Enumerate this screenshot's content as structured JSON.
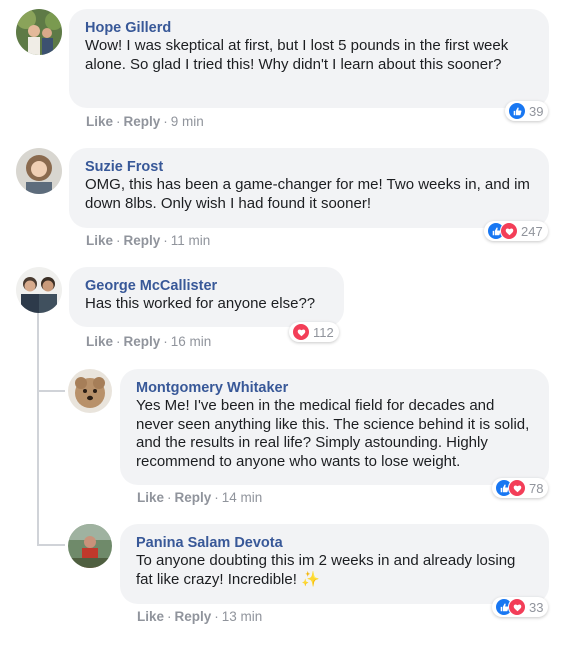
{
  "comments": [
    {
      "name": "Hope Gillerd",
      "text": "Wow! I was skeptical at first, but I lost 5 pounds in the first week alone. So glad I tried this! Why didn't I learn about this sooner?",
      "like": "Like",
      "reply": "Reply",
      "time": "9 min",
      "reaction_count": "39",
      "reactions": [
        "like"
      ]
    },
    {
      "name": "Suzie Frost",
      "text": "OMG, this has been a game-changer for me! Two weeks in, and im down 8lbs. Only wish I had found it sooner!",
      "like": "Like",
      "reply": "Reply",
      "time": "11 min",
      "reaction_count": "247",
      "reactions": [
        "like",
        "love"
      ]
    },
    {
      "name": "George McCallister",
      "text": "Has this worked for anyone else??",
      "like": "Like",
      "reply": "Reply",
      "time": "16 min",
      "reaction_count": "112",
      "reactions": [
        "love"
      ]
    },
    {
      "name": "Montgomery Whitaker",
      "text": "Yes Me! I've been in the medical field for decades and never seen anything like this. The science behind it is solid, and the results in real life? Simply astounding. Highly recommend to anyone who wants to lose weight.",
      "like": "Like",
      "reply": "Reply",
      "time": "14 min",
      "reaction_count": "78",
      "reactions": [
        "like",
        "love"
      ]
    },
    {
      "name": "Panina Salam Devota",
      "text": "To anyone doubting this im 2 weeks in and already losing fat like crazy! Incredible! ✨",
      "like": "Like",
      "reply": "Reply",
      "time": "13 min",
      "reaction_count": "33",
      "reactions": [
        "like",
        "love"
      ]
    }
  ],
  "separator": "·",
  "colors": {
    "name": "#385898",
    "bubble": "#f2f3f5",
    "meta": "#90949c",
    "like_reaction": "#1877f2",
    "love_reaction": "#f33e58"
  }
}
